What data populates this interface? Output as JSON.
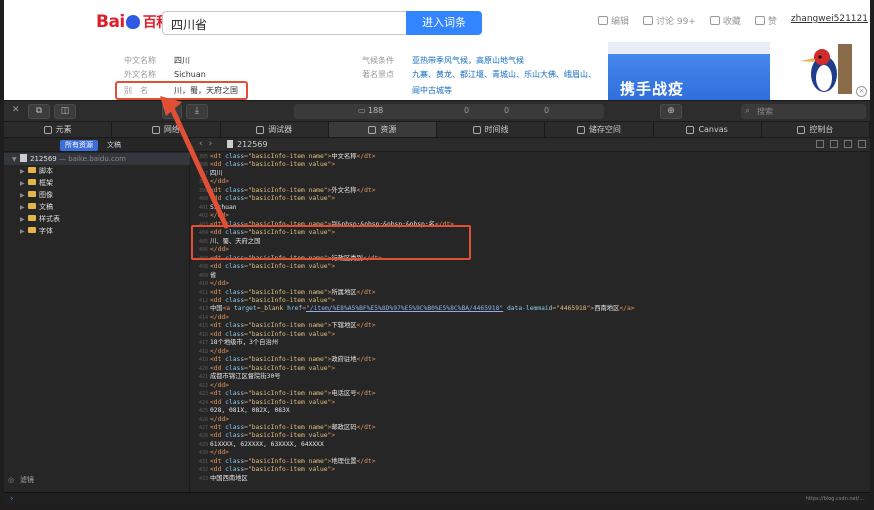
{
  "baidu": {
    "logo_text": "Bai",
    "logo_text2": "百科",
    "search_value": "四川省",
    "search_button": "进入词条",
    "top_links": [
      {
        "label": "编辑",
        "icon": "pencil-icon"
      },
      {
        "label": "讨论 99+",
        "icon": "comment-icon"
      },
      {
        "label": "收藏",
        "icon": "star-icon"
      },
      {
        "label": "赞",
        "icon": "thumb-icon"
      }
    ],
    "username": "zhangwei521121",
    "info_left": [
      {
        "k": "中文名称",
        "v": "四川"
      },
      {
        "k": "外文名称",
        "v": "Sichuan"
      },
      {
        "k": "别　名",
        "v": "川，蜀，天府之国"
      }
    ],
    "info_right": [
      {
        "k": "气候条件",
        "v": "亚热带季风气候，高原山地气候"
      },
      {
        "k": "著名景点",
        "v": "九寨、黄龙、都江堰、青城山、乐山大佛、峨眉山、"
      },
      {
        "k": "",
        "v": "阆中古城等"
      }
    ],
    "ad_text": "携手战疫"
  },
  "devtools": {
    "resource_count": "188",
    "center_counts": [
      "0",
      "0",
      "0"
    ],
    "search_placeholder": "搜索",
    "tabs": [
      {
        "label": "元素",
        "icon": "elements-icon"
      },
      {
        "label": "网络",
        "icon": "network-icon"
      },
      {
        "label": "调试器",
        "icon": "debugger-icon"
      },
      {
        "label": "资源",
        "icon": "resources-icon"
      },
      {
        "label": "时间线",
        "icon": "timeline-icon"
      },
      {
        "label": "储存空间",
        "icon": "storage-icon"
      },
      {
        "label": "Canvas",
        "icon": "canvas-icon"
      },
      {
        "label": "控制台",
        "icon": "console-icon"
      }
    ],
    "active_tab": "资源",
    "sidebar": {
      "seg_all": "所有资源",
      "seg_docs": "文稿",
      "root_id": "212569",
      "root_host": "— baike.baidu.com",
      "folders": [
        "脚本",
        "框架",
        "图像",
        "文稿",
        "样式表",
        "字体"
      ],
      "filter": "滤镜"
    },
    "file_name": "212569"
  },
  "code_lines": [
    {
      "n": "395",
      "parts": [
        [
          "tag",
          "<dt "
        ],
        [
          "attr",
          "class"
        ],
        [
          "tag",
          "="
        ],
        [
          "str",
          "\"basicInfo-item name\""
        ],
        [
          "tag",
          ">"
        ],
        [
          "txt",
          "中文名称"
        ],
        [
          "tag",
          "</dt>"
        ]
      ]
    },
    {
      "n": "396",
      "parts": [
        [
          "tag",
          "<dd "
        ],
        [
          "attr",
          "class"
        ],
        [
          "tag",
          "="
        ],
        [
          "str",
          "\"basicInfo-item value\""
        ],
        [
          "tag",
          ">"
        ]
      ]
    },
    {
      "n": "397",
      "parts": [
        [
          "txt",
          "四川"
        ]
      ]
    },
    {
      "n": "398",
      "parts": [
        [
          "tag",
          "</dd>"
        ]
      ]
    },
    {
      "n": "399",
      "parts": [
        [
          "tag",
          "<dt "
        ],
        [
          "attr",
          "class"
        ],
        [
          "tag",
          "="
        ],
        [
          "str",
          "\"basicInfo-item name\""
        ],
        [
          "tag",
          ">"
        ],
        [
          "txt",
          "外文名称"
        ],
        [
          "tag",
          "</dt>"
        ]
      ]
    },
    {
      "n": "400",
      "parts": [
        [
          "tag",
          "<dd "
        ],
        [
          "attr",
          "class"
        ],
        [
          "tag",
          "="
        ],
        [
          "str",
          "\"basicInfo-item value\""
        ],
        [
          "tag",
          ">"
        ]
      ]
    },
    {
      "n": "401",
      "parts": [
        [
          "txt",
          "Sichuan"
        ]
      ]
    },
    {
      "n": "402",
      "parts": [
        [
          "tag",
          "</dd>"
        ]
      ]
    },
    {
      "n": "403",
      "parts": [
        [
          "tag",
          "<dt "
        ],
        [
          "attr",
          "class"
        ],
        [
          "tag",
          "="
        ],
        [
          "str",
          "\"basicInfo-item name\""
        ],
        [
          "tag",
          ">"
        ],
        [
          "txt",
          "别&nbsp;&nbsp;&nbsp;&nbsp;名"
        ],
        [
          "tag",
          "</dt>"
        ]
      ]
    },
    {
      "n": "404",
      "parts": [
        [
          "tag",
          "<dd "
        ],
        [
          "attr",
          "class"
        ],
        [
          "tag",
          "="
        ],
        [
          "str",
          "\"basicInfo-item value\""
        ],
        [
          "tag",
          ">"
        ]
      ]
    },
    {
      "n": "405",
      "parts": [
        [
          "txt",
          "川、蜀、天府之国"
        ]
      ]
    },
    {
      "n": "406",
      "parts": [
        [
          "tag",
          "</dd>"
        ]
      ]
    },
    {
      "n": "407",
      "parts": [
        [
          "tag",
          "<dt "
        ],
        [
          "attr",
          "class"
        ],
        [
          "tag",
          "="
        ],
        [
          "str",
          "\"basicInfo-item name\""
        ],
        [
          "tag",
          ">"
        ],
        [
          "txt",
          "行政区类别"
        ],
        [
          "tag",
          "</dt>"
        ]
      ]
    },
    {
      "n": "408",
      "parts": [
        [
          "tag",
          "<dd "
        ],
        [
          "attr",
          "class"
        ],
        [
          "tag",
          "="
        ],
        [
          "str",
          "\"basicInfo-item value\""
        ],
        [
          "tag",
          ">"
        ]
      ]
    },
    {
      "n": "409",
      "parts": [
        [
          "txt",
          "省"
        ]
      ]
    },
    {
      "n": "410",
      "parts": [
        [
          "tag",
          "</dd>"
        ]
      ]
    },
    {
      "n": "411",
      "parts": [
        [
          "tag",
          "<dt "
        ],
        [
          "attr",
          "class"
        ],
        [
          "tag",
          "="
        ],
        [
          "str",
          "\"basicInfo-item name\""
        ],
        [
          "tag",
          ">"
        ],
        [
          "txt",
          "所属地区"
        ],
        [
          "tag",
          "</dt>"
        ]
      ]
    },
    {
      "n": "412",
      "parts": [
        [
          "tag",
          "<dd "
        ],
        [
          "attr",
          "class"
        ],
        [
          "tag",
          "="
        ],
        [
          "str",
          "\"basicInfo-item value\""
        ],
        [
          "tag",
          ">"
        ]
      ]
    },
    {
      "n": "413",
      "parts": [
        [
          "txt",
          "中国"
        ],
        [
          "tag",
          "<a "
        ],
        [
          "attr",
          "target"
        ],
        [
          "tag",
          "="
        ],
        [
          "str",
          "_blank "
        ],
        [
          "attr",
          "href"
        ],
        [
          "tag",
          "="
        ],
        [
          "url",
          "\"/item/%E8%A5%BF%E5%8D%97%E5%9C%B0%E5%8C%BA/4465918\""
        ],
        [
          "attr",
          " data-lemmaid"
        ],
        [
          "tag",
          "="
        ],
        [
          "str",
          "\"4465918\""
        ],
        [
          "tag",
          ">"
        ],
        [
          "txt",
          "西南地区"
        ],
        [
          "tag",
          "</a>"
        ]
      ]
    },
    {
      "n": "414",
      "parts": [
        [
          "tag",
          "</dd>"
        ]
      ]
    },
    {
      "n": "415",
      "parts": [
        [
          "tag",
          "<dt "
        ],
        [
          "attr",
          "class"
        ],
        [
          "tag",
          "="
        ],
        [
          "str",
          "\"basicInfo-item name\""
        ],
        [
          "tag",
          ">"
        ],
        [
          "txt",
          "下辖地区"
        ],
        [
          "tag",
          "</dt>"
        ]
      ]
    },
    {
      "n": "416",
      "parts": [
        [
          "tag",
          "<dd "
        ],
        [
          "attr",
          "class"
        ],
        [
          "tag",
          "="
        ],
        [
          "str",
          "\"basicInfo-item value\""
        ],
        [
          "tag",
          ">"
        ]
      ]
    },
    {
      "n": "417",
      "parts": [
        [
          "txt",
          "18个地级市，3个自治州"
        ]
      ]
    },
    {
      "n": "418",
      "parts": [
        [
          "tag",
          "</dd>"
        ]
      ]
    },
    {
      "n": "419",
      "parts": [
        [
          "tag",
          "<dt "
        ],
        [
          "attr",
          "class"
        ],
        [
          "tag",
          "="
        ],
        [
          "str",
          "\"basicInfo-item name\""
        ],
        [
          "tag",
          ">"
        ],
        [
          "txt",
          "政府驻地"
        ],
        [
          "tag",
          "</dt>"
        ]
      ]
    },
    {
      "n": "420",
      "parts": [
        [
          "tag",
          "<dd "
        ],
        [
          "attr",
          "class"
        ],
        [
          "tag",
          "="
        ],
        [
          "str",
          "\"basicInfo-item value\""
        ],
        [
          "tag",
          ">"
        ]
      ]
    },
    {
      "n": "421",
      "parts": [
        [
          "txt",
          "成都市锦江区督院街30号"
        ]
      ]
    },
    {
      "n": "422",
      "parts": [
        [
          "tag",
          "</dd>"
        ]
      ]
    },
    {
      "n": "423",
      "parts": [
        [
          "tag",
          "<dt "
        ],
        [
          "attr",
          "class"
        ],
        [
          "tag",
          "="
        ],
        [
          "str",
          "\"basicInfo-item name\""
        ],
        [
          "tag",
          ">"
        ],
        [
          "txt",
          "电话区号"
        ],
        [
          "tag",
          "</dt>"
        ]
      ]
    },
    {
      "n": "424",
      "parts": [
        [
          "tag",
          "<dd "
        ],
        [
          "attr",
          "class"
        ],
        [
          "tag",
          "="
        ],
        [
          "str",
          "\"basicInfo-item value\""
        ],
        [
          "tag",
          ">"
        ]
      ]
    },
    {
      "n": "425",
      "parts": [
        [
          "txt",
          "028, 081X, 082X, 083X"
        ]
      ]
    },
    {
      "n": "426",
      "parts": [
        [
          "tag",
          "</dd>"
        ]
      ]
    },
    {
      "n": "427",
      "parts": [
        [
          "tag",
          "<dt "
        ],
        [
          "attr",
          "class"
        ],
        [
          "tag",
          "="
        ],
        [
          "str",
          "\"basicInfo-item name\""
        ],
        [
          "tag",
          ">"
        ],
        [
          "txt",
          "邮政区码"
        ],
        [
          "tag",
          "</dt>"
        ]
      ]
    },
    {
      "n": "428",
      "parts": [
        [
          "tag",
          "<dd "
        ],
        [
          "attr",
          "class"
        ],
        [
          "tag",
          "="
        ],
        [
          "str",
          "\"basicInfo-item value\""
        ],
        [
          "tag",
          ">"
        ]
      ]
    },
    {
      "n": "429",
      "parts": [
        [
          "txt",
          "61XXXX, 62XXXX, 63XXXX, 64XXXX"
        ]
      ]
    },
    {
      "n": "430",
      "parts": [
        [
          "tag",
          "</dd>"
        ]
      ]
    },
    {
      "n": "431",
      "parts": [
        [
          "tag",
          "<dt "
        ],
        [
          "attr",
          "class"
        ],
        [
          "tag",
          "="
        ],
        [
          "str",
          "\"basicInfo-item name\""
        ],
        [
          "tag",
          ">"
        ],
        [
          "txt",
          "地理位置"
        ],
        [
          "tag",
          "</dt>"
        ]
      ]
    },
    {
      "n": "432",
      "parts": [
        [
          "tag",
          "<dd "
        ],
        [
          "attr",
          "class"
        ],
        [
          "tag",
          "="
        ],
        [
          "str",
          "\"basicInfo-item value\""
        ],
        [
          "tag",
          ">"
        ]
      ]
    },
    {
      "n": "433",
      "parts": [
        [
          "txt",
          "中国西南地区"
        ]
      ]
    }
  ],
  "watermark": "https://blog.csdn.net/...",
  "colors": {
    "accent": "#3385ff",
    "annotation": "#e14f35",
    "tag": "#e29561",
    "attr": "#8ec9e8",
    "string": "#e2c081"
  }
}
